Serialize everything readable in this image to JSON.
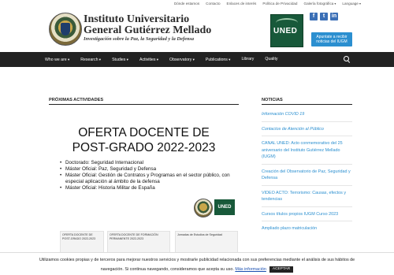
{
  "topbar": {
    "links": [
      "Dónde estamos",
      "Contacto",
      "Enlaces de interés",
      "Política de Privacidad",
      "Galería fotográfica",
      "Language"
    ]
  },
  "header": {
    "institute_name_line1": "Instituto Universitario",
    "institute_name_line2": "General Gutiérrez Mellado",
    "tagline": "Investigación sobre la Paz, la Seguridad y la Defensa",
    "uned_logo_text": "UNED",
    "subscribe_button": "Apuntate a recibir noticias del IUGM",
    "social_icons": [
      "facebook-icon",
      "twitter-icon",
      "linkedin-icon"
    ]
  },
  "nav": {
    "items": [
      "Who we are",
      "Research",
      "Studies",
      "Activities",
      "Observatory",
      "Publications",
      "Library",
      "Quality"
    ]
  },
  "main": {
    "section_title": "PRÓXIMAS ACTIVIDADES",
    "poster": {
      "title_line1": "OFERTA DOCENTE DE",
      "title_line2": "POST-GRADO 2022-2023",
      "items": [
        "Doctorado: Seguridad Internacional",
        "Máster Oficial: Paz, Seguridad y Defensa",
        "Máster Oficial: Gestión de Contratos y Programas en el sector público, con especial aplicación al ámbito de la defensa",
        "Máster Oficial: Historia Militar de España"
      ],
      "uned_text": "UNED"
    },
    "thumbnails": [
      "OFERTA DOCENTE DE POST-GRADO 2022-2023",
      "OFERTA DOCENTE DE FORMACIÓN PERMANENTE 2022-2023",
      "Jornadas de Estudios de Seguridad"
    ]
  },
  "sidebar": {
    "title": "NOTICIAS",
    "items": [
      "Información COVID 19",
      "Contactos de Atención al Público",
      "CANAL UNED: Acto conmemorativo del 25 aniversario del Instituto Gutiérrez Mellado (IUGM)",
      "Creación del Observatorio de Paz, Seguridad y Defensa",
      "VIDEO ACTO: Terrorismo: Causas, efectos y tendencias",
      "Cursos títulos propios IUGM Curso 2023",
      "Ampliado plazo matriculación"
    ]
  },
  "cookie": {
    "line1": "Utilizamos cookies propias y de terceros para mejorar nuestros servicios y mostrarle publicidad relacionada con sus preferencias mediante el análisis de sus hábitos de",
    "line2": "navegación. Si continua navegando, consideramos que acepta su uso.",
    "more_info": "Más información",
    "accept": "ACEPTAR"
  },
  "colors": {
    "nav_bg": "#222222",
    "link_blue": "#2b8fd0",
    "uned_green": "#18593a"
  }
}
